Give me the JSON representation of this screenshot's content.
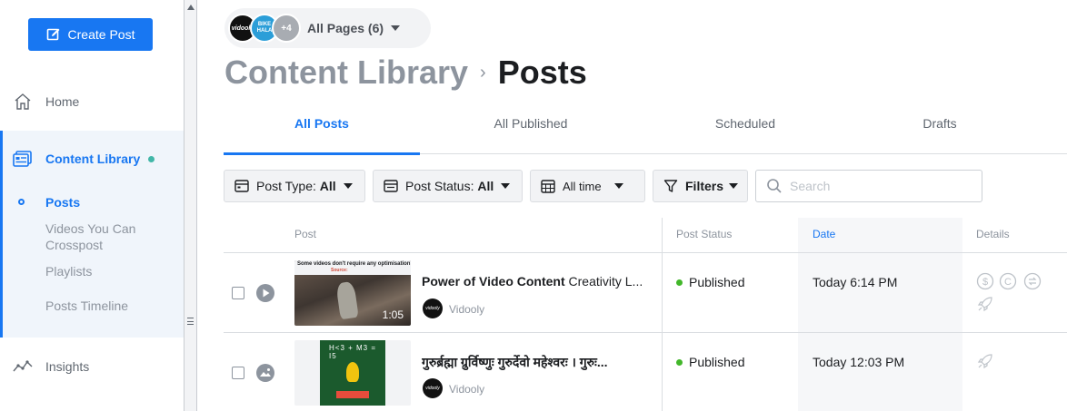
{
  "sidebar": {
    "create_label": "Create Post",
    "home": "Home",
    "content_library": "Content Library",
    "sub_items": [
      "Posts",
      "Videos You Can",
      "Crosspost",
      "Playlists",
      "Posts Timeline"
    ],
    "insights": "Insights"
  },
  "header": {
    "avatars": [
      "vidooly",
      "BIKE HALA",
      "+4"
    ],
    "pages_label": "All Pages (6)",
    "breadcrumb_parent": "Content Library",
    "breadcrumb_sep": "›",
    "breadcrumb_current": "Posts"
  },
  "tabs": [
    "All Posts",
    "All Published",
    "Scheduled",
    "Drafts"
  ],
  "active_tab": "All Posts",
  "filters": {
    "post_type_label": "Post Type:",
    "post_type_value": "All",
    "post_status_label": "Post Status:",
    "post_status_value": "All",
    "time_value": "All time",
    "filters_label": "Filters",
    "search_placeholder": "Search"
  },
  "table": {
    "columns": [
      "Post",
      "Post Status",
      "Date",
      "Details"
    ],
    "rows": [
      {
        "type_icon": "play-icon",
        "thumb_caption": "Some videos don't require any optimisation",
        "thumb_source": "Source:",
        "duration": "1:05",
        "title_bold": "Power of Video Content",
        "title_rest": " Creativity L...",
        "page": "Vidooly",
        "status": "Published",
        "date": "Today 6:14 PM",
        "details_icons": [
          "dollar-icon",
          "copyright-icon",
          "crosspost-icon",
          "boost-rocket-icon"
        ]
      },
      {
        "type_icon": "photo-icon",
        "thumb_caption": "H<3 + M3 = I5",
        "title_bold": "गुरुर्ब्रह्मा ग्रुर्विष्णुः गुरुर्देवो महेश्वरः । गुरुः...",
        "title_rest": "",
        "page": "Vidooly",
        "status": "Published",
        "date": "Today 12:03 PM",
        "details_icons": [
          "boost-rocket-icon"
        ]
      }
    ]
  },
  "colors": {
    "accent": "#1877f2",
    "published": "#42b72a",
    "library_dot": "#42b7a8"
  }
}
